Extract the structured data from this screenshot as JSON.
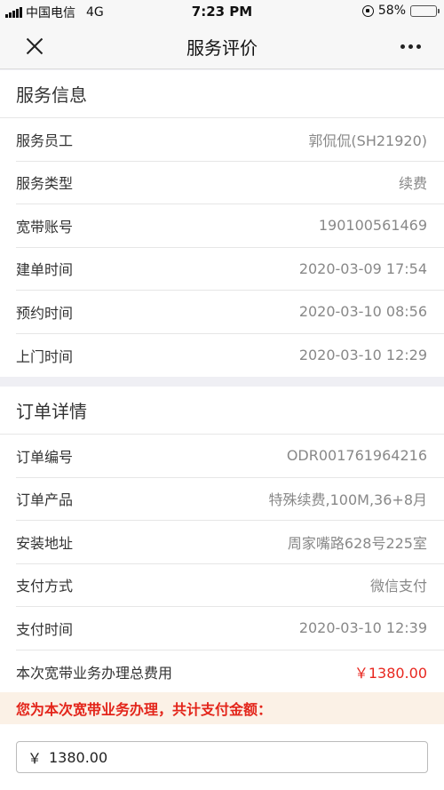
{
  "status_bar": {
    "carrier": "中国电信",
    "network": "4G",
    "time": "7:23 PM",
    "battery_percent": "58%",
    "battery_level": 0.58
  },
  "nav": {
    "title": "服务评价"
  },
  "service_info": {
    "title": "服务信息",
    "rows": [
      {
        "label": "服务员工",
        "value": "郭侃侃(SH21920)"
      },
      {
        "label": "服务类型",
        "value": "续费"
      },
      {
        "label": "宽带账号",
        "value": "190100561469"
      },
      {
        "label": "建单时间",
        "value": "2020-03-09 17:54"
      },
      {
        "label": "预约时间",
        "value": "2020-03-10 08:56"
      },
      {
        "label": "上门时间",
        "value": "2020-03-10 12:29"
      }
    ]
  },
  "order_detail": {
    "title": "订单详情",
    "rows": [
      {
        "label": "订单编号",
        "value": "ODR001761964216"
      },
      {
        "label": "订单产品",
        "value": "特殊续费,100M,36+8月"
      },
      {
        "label": "安装地址",
        "value": "周家嘴路628号225室"
      },
      {
        "label": "支付方式",
        "value": "微信支付"
      },
      {
        "label": "支付时间",
        "value": "2020-03-10 12:39"
      },
      {
        "label": "本次宽带业务办理总费用",
        "value": "￥1380.00"
      }
    ]
  },
  "payment": {
    "notice": "您为本次宽带业务办理，共计支付金额：",
    "currency_symbol": "￥",
    "amount": "1380.00"
  },
  "colors": {
    "accent_red": "#e8271f",
    "notice_bg": "#fbf1e6",
    "battery": "#f4c431"
  }
}
